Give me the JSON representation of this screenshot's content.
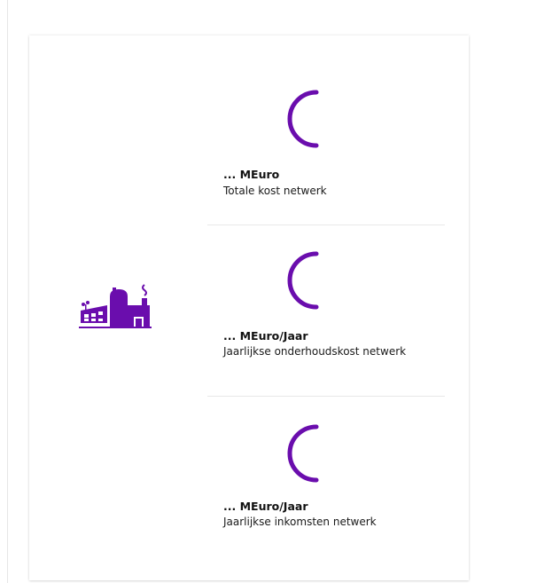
{
  "colors": {
    "accent": "#6a0dad",
    "card_background": "#ffffff",
    "divider": "#e8e8e8"
  },
  "facility": {
    "icon": "industrial-facility-icon"
  },
  "stats": [
    {
      "value": "... MEuro",
      "label": "Totale kost netwerk",
      "loading_icon": "loading-spinner-icon"
    },
    {
      "value": "... MEuro/Jaar",
      "label": "Jaarlijkse onderhoudskost netwerk",
      "loading_icon": "loading-spinner-icon"
    },
    {
      "value": "... MEuro/Jaar",
      "label": "Jaarlijkse inkomsten netwerk",
      "loading_icon": "loading-spinner-icon"
    }
  ]
}
